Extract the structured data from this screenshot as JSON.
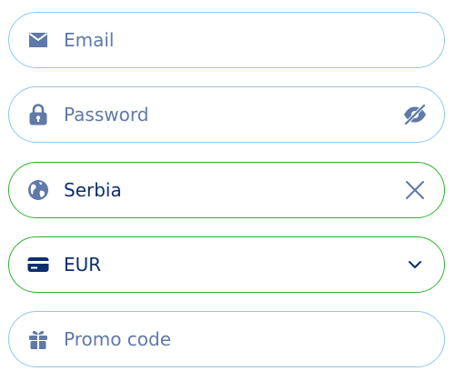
{
  "form": {
    "email": {
      "placeholder": "Email",
      "icon": "envelope-icon"
    },
    "password": {
      "placeholder": "Password",
      "icon": "lock-icon",
      "toggle_icon": "eye-off-icon"
    },
    "country": {
      "value": "Serbia",
      "icon": "globe-icon",
      "clear_icon": "close-icon"
    },
    "currency": {
      "value": "EUR",
      "icon": "credit-card-icon",
      "dropdown_icon": "chevron-down-icon"
    },
    "promo": {
      "placeholder": "Promo code",
      "icon": "gift-icon"
    }
  },
  "colors": {
    "border_default": "#8ec7f1",
    "border_valid": "#2db32d",
    "placeholder": "#5f79a8",
    "value_text": "#0b2f6e"
  }
}
